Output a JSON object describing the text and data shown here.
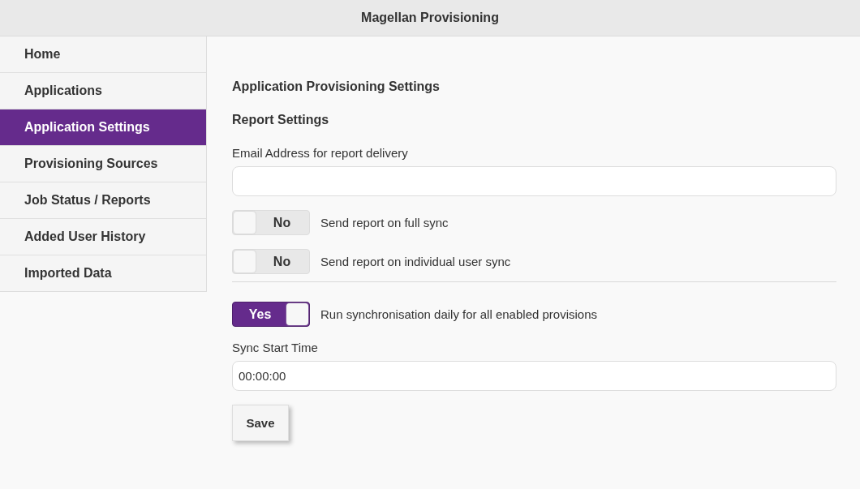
{
  "header": {
    "title": "Magellan Provisioning"
  },
  "sidebar": {
    "items": [
      {
        "label": "Home",
        "selected": false
      },
      {
        "label": "Applications",
        "selected": false
      },
      {
        "label": "Application Settings",
        "selected": true
      },
      {
        "label": "Provisioning Sources",
        "selected": false
      },
      {
        "label": "Job Status / Reports",
        "selected": false
      },
      {
        "label": "Added User History",
        "selected": false
      },
      {
        "label": "Imported Data",
        "selected": false
      }
    ]
  },
  "content": {
    "title": "Application Provisioning Settings",
    "section_title": "Report Settings",
    "controls": [
      {
        "kind": "field",
        "label": "Email Address for report delivery"
      },
      {
        "kind": "toggle",
        "on": false,
        "state_label": "No",
        "label": "Send report on full sync"
      },
      {
        "kind": "toggle",
        "on": false,
        "state_label": "No",
        "label": "Send report on individual user sync"
      },
      {
        "kind": "divider"
      },
      {
        "kind": "toggle",
        "on": true,
        "state_label": "Yes",
        "label": "Run synchronisation daily for all enabled provisions"
      },
      {
        "kind": "field",
        "label": "Sync Start Time",
        "value": "00:00:00"
      }
    ],
    "save_button": "Save"
  }
}
